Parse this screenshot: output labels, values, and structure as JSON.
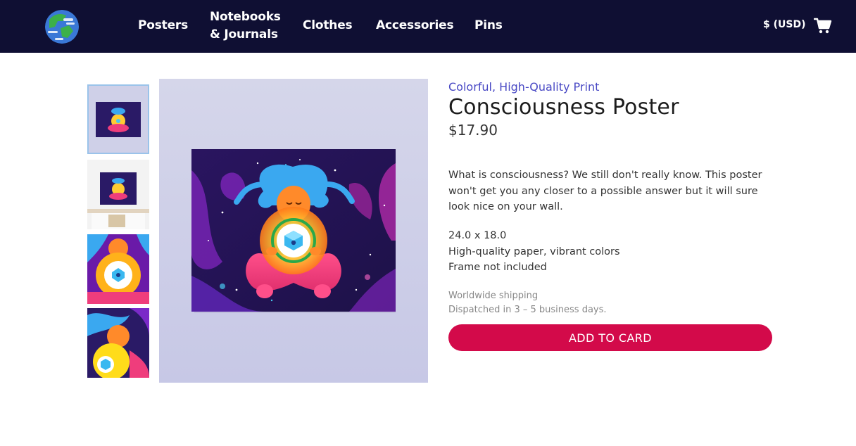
{
  "header": {
    "logo": "globe-logo",
    "nav": [
      {
        "label": "Posters"
      },
      {
        "line1": "Notebooks",
        "line2": "& Journals"
      },
      {
        "label": "Clothes"
      },
      {
        "label": "Accessories"
      },
      {
        "label": "Pins"
      }
    ],
    "currency": "$ (USD)",
    "cart_icon": "cart-icon",
    "background": "#0f0f33"
  },
  "product": {
    "tagline": "Colorful, High-Quality Print",
    "title": "Consciousness Poster",
    "price": "$17.90",
    "description": "What is consciousness? We still don't really know. This poster won't get you any closer to a possible answer but it will sure look nice on your wall.",
    "specs": [
      "24.0 x 18.0",
      "High-quality paper, vibrant colors",
      "Frame not included"
    ],
    "shipping": [
      "Worldwide shipping",
      "Dispatched in 3 – 5 business days."
    ],
    "add_button": "ADD TO CARD",
    "thumbnails": [
      "poster-front",
      "poster-in-room",
      "poster-detail-core",
      "poster-detail-hair"
    ],
    "colors": {
      "accent": "#d30a4a",
      "tagline": "#4848c4",
      "thumb_active": "#9ac3ea"
    }
  }
}
